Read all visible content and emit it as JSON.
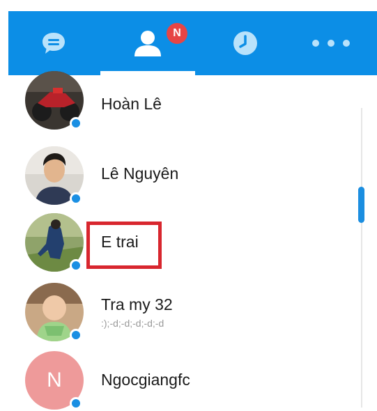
{
  "tabs": [
    {
      "id": "chat",
      "icon": "chat-bubble-icon",
      "active": false
    },
    {
      "id": "contacts",
      "icon": "contacts-icon",
      "active": true,
      "badge": "N"
    },
    {
      "id": "timeline",
      "icon": "clock-icon",
      "active": false
    },
    {
      "id": "more",
      "icon": "more-dots-icon",
      "active": false
    }
  ],
  "colors": {
    "header_bg": "#0c8ee6",
    "badge_bg": "#e64545",
    "online_dot": "#1a8fe3",
    "highlight": "#d8262e",
    "initial_avatar_bg": "#ee9a9a"
  },
  "contacts": [
    {
      "name": "Hoàn Lê",
      "subtitle": "",
      "avatar": "photo-motorbike",
      "online": true
    },
    {
      "name": "Lê Nguyên",
      "subtitle": "",
      "avatar": "photo-man",
      "online": true
    },
    {
      "name": "E trai",
      "subtitle": "",
      "avatar": "photo-field",
      "online": true,
      "highlighted": true
    },
    {
      "name": "Tra my 32",
      "subtitle": ":);-d;-d;-d;-d;-d",
      "avatar": "photo-baby",
      "online": true
    },
    {
      "name": "Ngocgiangfc",
      "subtitle": "",
      "avatar": "initial",
      "initial": "N",
      "online": true
    }
  ]
}
